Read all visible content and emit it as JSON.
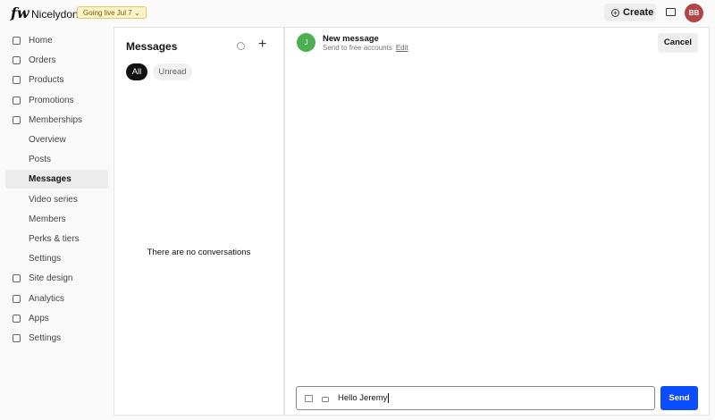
{
  "header": {
    "logo": "fw",
    "brand": "Nicelydone",
    "badge": "Going live Jul 7 ⌄",
    "create": "Create",
    "avatar": "BB"
  },
  "sidebar": {
    "items": [
      {
        "label": "Home",
        "icon": "home-icon"
      },
      {
        "label": "Orders",
        "icon": "dollar-icon"
      },
      {
        "label": "Products",
        "icon": "shirt-icon"
      },
      {
        "label": "Promotions",
        "icon": "tag-icon"
      },
      {
        "label": "Memberships",
        "icon": "star-icon"
      },
      {
        "label": "Overview"
      },
      {
        "label": "Posts"
      },
      {
        "label": "Messages",
        "active": true
      },
      {
        "label": "Video series"
      },
      {
        "label": "Members"
      },
      {
        "label": "Perks & tiers"
      },
      {
        "label": "Settings"
      },
      {
        "label": "Site design",
        "icon": "layout-icon"
      },
      {
        "label": "Analytics",
        "icon": "chart-icon"
      },
      {
        "label": "Apps",
        "icon": "grid-icon"
      },
      {
        "label": "Settings",
        "icon": "gear-icon"
      }
    ]
  },
  "messages": {
    "title": "Messages",
    "filters": {
      "all": "All",
      "unread": "Unread"
    },
    "empty": "There are no conversations"
  },
  "compose": {
    "avatar": "J",
    "title": "New message",
    "subtitle": "Send to free accounts",
    "edit": "Edit",
    "cancel": "Cancel",
    "input_value": "Hello Jeremy",
    "send": "Send"
  }
}
